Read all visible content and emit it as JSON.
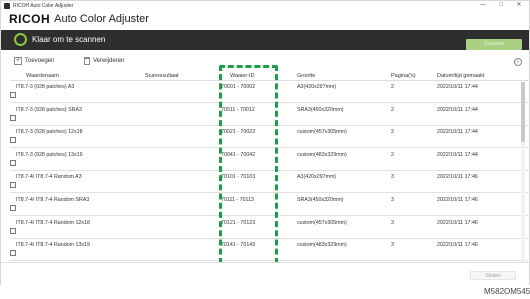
{
  "window": {
    "title": "RICOH Auto Color Adjuster",
    "controls": [
      "—",
      "□",
      "✕"
    ]
  },
  "brand": {
    "logo": "RICOH",
    "name": "Auto Color Adjuster"
  },
  "status": {
    "text": "Klaar om te scannen",
    "scan_button": "Scannen",
    "accent": "#8cc63f"
  },
  "toolbar": {
    "add_label": "Toevoegen",
    "delete_label": "Verwijderen",
    "info_icon": "info-icon"
  },
  "table": {
    "headers": [
      "Waardenaam",
      "Scanresultaat",
      "Waaier-ID",
      "Grootte",
      "Pagina('s)",
      "Datum/tijd gemaakt"
    ],
    "rows": [
      {
        "name": "IT8.7-3 (928 patches) A3",
        "result": "",
        "id": "70001 - 70002",
        "size": "A3(420x297mm)",
        "pages": "2",
        "date": "2022/10/11 17:44"
      },
      {
        "name": "IT8.7-3 (928 patches) SRA3",
        "result": "",
        "id": "70011 - 70012",
        "size": "SRA3(450x320mm)",
        "pages": "2",
        "date": "2022/10/11 17:44"
      },
      {
        "name": "IT8.7-3 (928 patches) 12x18",
        "result": "",
        "id": "70021 - 70022",
        "size": "custom(457x305mm)",
        "pages": "2",
        "date": "2022/10/11 17:44"
      },
      {
        "name": "IT8.7-3 (928 patches) 13x19",
        "result": "",
        "id": "70041 - 70042",
        "size": "custom(483x329mm)",
        "pages": "2",
        "date": "2022/10/11 17:44"
      },
      {
        "name": "IT8.7-4/ IT8.7-4 Random A3",
        "result": "",
        "id": "70101 - 70103",
        "size": "A3(420x297mm)",
        "pages": "3",
        "date": "2022/10/11 17:46"
      },
      {
        "name": "IT8.7-4/ IT8.7-4 Random SRA3",
        "result": "",
        "id": "70111 - 70113",
        "size": "SRA3(450x320mm)",
        "pages": "3",
        "date": "2022/10/11 17:46"
      },
      {
        "name": "IT8.7-4/ IT8.7-4 Random 12x18",
        "result": "",
        "id": "70121 - 70123",
        "size": "custom(457x305mm)",
        "pages": "3",
        "date": "2022/10/11 17:46"
      },
      {
        "name": "IT8.7-4/ IT8.7-4 Random 13x19",
        "result": "",
        "id": "70141 - 70143",
        "size": "custom(483x329mm)",
        "pages": "3",
        "date": "2022/10/11 17:46"
      }
    ]
  },
  "footer": {
    "close_label": "Sluiten"
  },
  "figure_code": "M582OM545"
}
